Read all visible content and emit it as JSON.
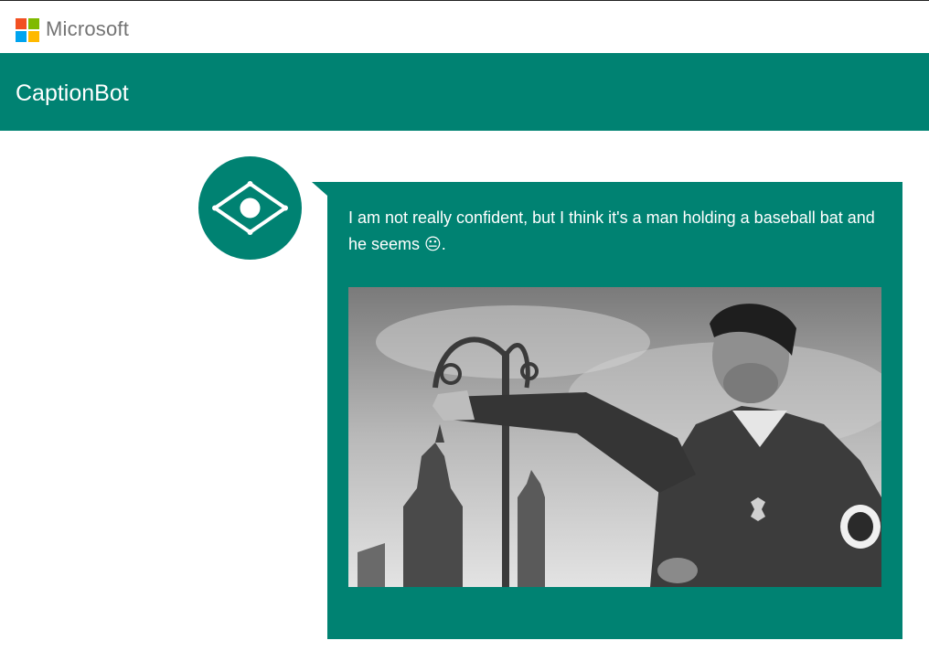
{
  "brand": {
    "logo_label": "Microsoft",
    "logo_colors": [
      "#f25022",
      "#7fba00",
      "#00a4ef",
      "#ffb900"
    ]
  },
  "header": {
    "title": "CaptionBot",
    "accent_color": "#008272"
  },
  "message": {
    "text": "I am not really confident, but I think it's a man holding a baseball bat and he seems 😐.",
    "bot_icon": "eye-diamond-icon",
    "photo": "grayscale-historical-photo"
  }
}
